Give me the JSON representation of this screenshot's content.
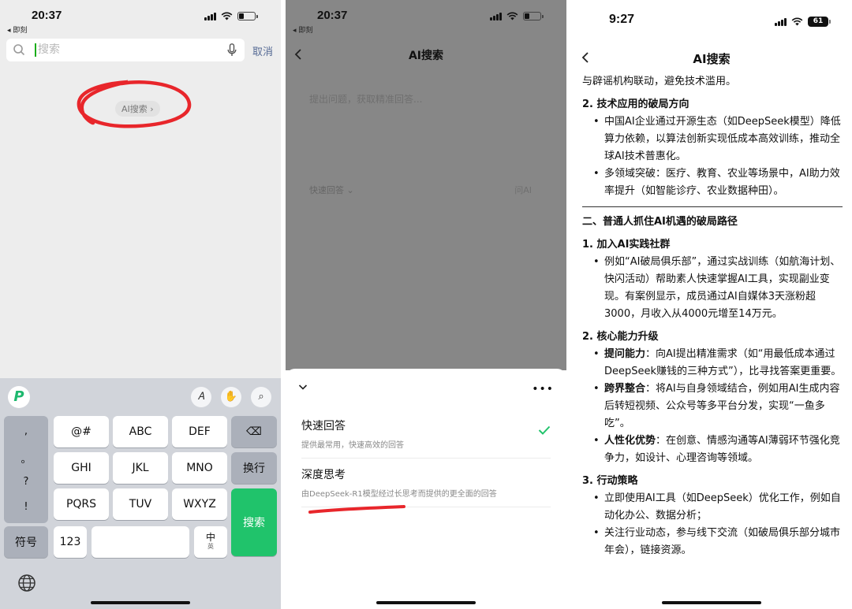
{
  "panel1": {
    "status": {
      "time": "20:37",
      "back": "◂ 即刻"
    },
    "search": {
      "placeholder": "搜索",
      "cancel": "取消"
    },
    "ai_chip": "AI搜索 ›",
    "keyboard": {
      "tools": {
        "handwrite": "𝐴",
        "emoji_hand": "✋",
        "search": "⌕"
      },
      "punct": [
        ",",
        "。",
        "?",
        "!"
      ],
      "keys": [
        "@#",
        "ABC",
        "DEF",
        "GHI",
        "JKL",
        "MNO",
        "PQRS",
        "TUV",
        "WXYZ"
      ],
      "delete": "⌫",
      "newline": "换行",
      "search_key": "搜索",
      "symbols": "符号",
      "numbers": "123",
      "space": "",
      "lang_zh": "中",
      "lang_en": "英"
    }
  },
  "panel2": {
    "status": {
      "time": "20:37",
      "back": "◂ 即刻"
    },
    "title": "AI搜索",
    "placeholder": "提出问题，获取精准回答...",
    "quick_mode": "快速回答 ⌄",
    "ask_ai": "问AI",
    "sheet": {
      "more": "•••",
      "options": [
        {
          "title": "快速回答",
          "desc": "提供最常用，快速高效的回答",
          "selected": true
        },
        {
          "title": "深度思考",
          "desc": "由DeepSeek-R1模型经过长思考而提供的更全面的回答",
          "selected": false
        }
      ]
    }
  },
  "panel3": {
    "status": {
      "time": "9:27",
      "battery": "61"
    },
    "title": "AI搜索",
    "article": {
      "line0": "与辟谣机构联动，避免技术滥用。",
      "s2_head": "2. 技术应用的破局方向",
      "s2_b1": "中国AI企业通过开源生态（如DeepSeek模型）降低算力依赖，以算法创新实现低成本高效训练，推动全球AI技术普惠化。",
      "s2_b2": "多领域突破：医疗、教育、农业等场景中，AI助力效率提升（如智能诊疗、农业数据种田）。",
      "part2_head": "二、普通人抓住AI机遇的破局路径",
      "p1_head": "1. 加入AI实践社群",
      "p1_b1": "例如“AI破局俱乐部”，通过实战训练（如航海计划、快闪活动）帮助素人快速掌握AI工具，实现副业变现。有案例显示，成员通过AI自媒体3天涨粉超3000，月收入从4000元增至14万元。",
      "p2_head": "2. 核心能力升级",
      "p2_b1_label": "提问能力",
      "p2_b1_text": "：向AI提出精准需求（如“用最低成本通过DeepSeek赚钱的三种方式”），比寻找答案更重要。",
      "p2_b2_label": "跨界整合",
      "p2_b2_text": "：将AI与自身领域结合，例如用AI生成内容后转短视频、公众号等多平台分发，实现“一鱼多吃”。",
      "p2_b3_label": "人性化优势",
      "p2_b3_text": "：在创意、情感沟通等AI薄弱环节强化竞争力，如设计、心理咨询等领域。",
      "p3_head": "3. 行动策略",
      "p3_b1": "立即使用AI工具（如DeepSeek）优化工作，例如自动化办公、数据分析；",
      "p3_b2": "关注行业动态，参与线下交流（如破局俱乐部分城市年会），链接资源。"
    }
  },
  "colors": {
    "accent_green": "#20c36b",
    "scribble_red": "#e8262b",
    "link_blue": "#576b95"
  }
}
